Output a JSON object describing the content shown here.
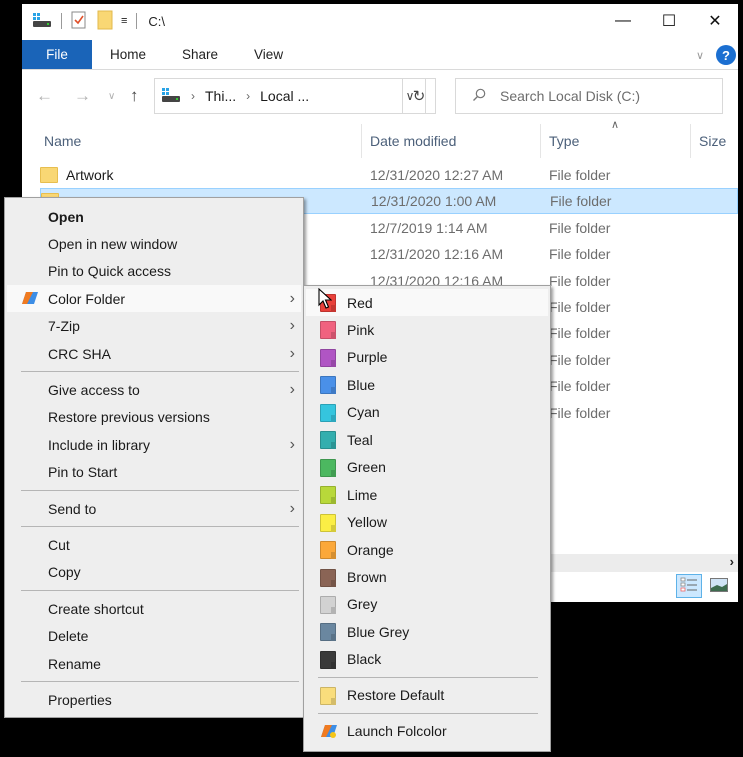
{
  "window": {
    "title": "C:\\",
    "controls": {
      "minimize": "—",
      "maximize": "☐",
      "close": "✕"
    }
  },
  "ribbon": {
    "tabs": [
      "File",
      "Home",
      "Share",
      "View"
    ],
    "help": "?"
  },
  "navigation": {
    "breadcrumbs": [
      "Thi...",
      "Local ..."
    ],
    "search_placeholder": "Search Local Disk (C:)"
  },
  "columns": [
    "Name",
    "Date modified",
    "Type",
    "Size"
  ],
  "rows": [
    {
      "name": "Artwork",
      "date": "12/31/2020 12:27 AM",
      "type": "File folder",
      "selected": false
    },
    {
      "name": "",
      "date": "12/31/2020 1:00 AM",
      "type": "File folder",
      "selected": true
    },
    {
      "name": "",
      "date": "12/7/2019 1:14 AM",
      "type": "File folder",
      "selected": false
    },
    {
      "name": "",
      "date": "12/31/2020 12:16 AM",
      "type": "File folder",
      "selected": false
    },
    {
      "name": "",
      "date": "12/31/2020 12:16 AM",
      "type": "File folder",
      "selected": false
    },
    {
      "name": "",
      "date": "",
      "type": "File folder",
      "selected": false
    },
    {
      "name": "",
      "date": "",
      "type": "File folder",
      "selected": false
    },
    {
      "name": "",
      "date": "",
      "type": "File folder",
      "selected": false
    },
    {
      "name": "",
      "date": "",
      "type": "File folder",
      "selected": false
    },
    {
      "name": "",
      "date": "",
      "type": "File folder",
      "selected": false
    }
  ],
  "context_menu": {
    "items": [
      {
        "label": "Open",
        "bold": true
      },
      {
        "label": "Open in new window"
      },
      {
        "label": "Pin to Quick access"
      },
      {
        "label": "Color Folder",
        "submenu": true,
        "hover": true,
        "icon": "folcolor-icon"
      },
      {
        "label": "7-Zip",
        "submenu": true
      },
      {
        "label": "CRC SHA",
        "submenu": true
      },
      {
        "separator": true
      },
      {
        "label": "Give access to",
        "submenu": true
      },
      {
        "label": "Restore previous versions"
      },
      {
        "label": "Include in library",
        "submenu": true
      },
      {
        "label": "Pin to Start"
      },
      {
        "separator": true
      },
      {
        "label": "Send to",
        "submenu": true
      },
      {
        "separator": true
      },
      {
        "label": "Cut"
      },
      {
        "label": "Copy"
      },
      {
        "separator": true
      },
      {
        "label": "Create shortcut"
      },
      {
        "label": "Delete"
      },
      {
        "label": "Rename"
      },
      {
        "separator": true
      },
      {
        "label": "Properties"
      }
    ]
  },
  "color_submenu": {
    "items": [
      {
        "label": "Red",
        "color": "#e8403a",
        "hover": true
      },
      {
        "label": "Pink",
        "color": "#f0627f"
      },
      {
        "label": "Purple",
        "color": "#b055c4"
      },
      {
        "label": "Blue",
        "color": "#4a90e8"
      },
      {
        "label": "Cyan",
        "color": "#35c5de"
      },
      {
        "label": "Teal",
        "color": "#33aeae"
      },
      {
        "label": "Green",
        "color": "#4cb860"
      },
      {
        "label": "Lime",
        "color": "#b8d83a"
      },
      {
        "label": "Yellow",
        "color": "#fbee45"
      },
      {
        "label": "Orange",
        "color": "#fba83a"
      },
      {
        "label": "Brown",
        "color": "#8a6455"
      },
      {
        "label": "Grey",
        "color": "#d2d2d2"
      },
      {
        "label": "Blue Grey",
        "color": "#6a87a0"
      },
      {
        "label": "Black",
        "color": "#3a3a3a"
      },
      {
        "separator": true
      },
      {
        "label": "Restore Default",
        "color": "#f9dd7c"
      },
      {
        "separator": true
      },
      {
        "label": "Launch Folcolor",
        "icon": "folcolor-icon"
      }
    ]
  }
}
